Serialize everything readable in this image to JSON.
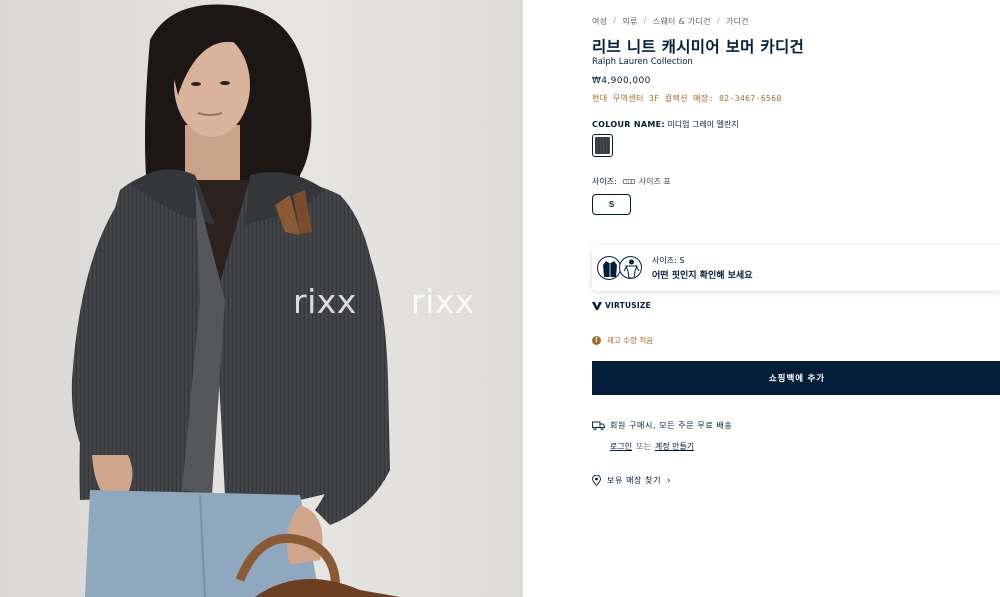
{
  "breadcrumb": [
    "여성",
    "의류",
    "스웨터 & 가디건",
    "가디건"
  ],
  "breadcrumb_separator": "/",
  "product": {
    "title": "리브 니트 캐시미어 보머 카디건",
    "brand": "Ralph Lauren Collection",
    "price": "₩4,900,000",
    "store_note": "현대 무역센터 3F 컬렉션 매장: 02-3467-6560"
  },
  "colour": {
    "label": "COLOUR NAME:",
    "value": "미디엄 그레이 멜란지",
    "swatch_color": "#3d3e41"
  },
  "size": {
    "label": "사이즈:",
    "chart_link": "사이즈 표",
    "selected": "S"
  },
  "virtusize": {
    "size_text": "사이즈: S",
    "message": "어떤 핏인지 확인해 보세요",
    "brand": "VIRTUSIZE"
  },
  "stock": {
    "text": "재고 수량 적음"
  },
  "add_to_bag": "쇼핑백에 추가",
  "shipping": {
    "text": "회원 구매시, 모든 주문 무료 배송"
  },
  "account": {
    "login": "로그인",
    "or": "또는",
    "create": "계정 만들기"
  },
  "store_finder": "보유 매장 찾기",
  "watermarks": [
    "rixx",
    "rixx"
  ],
  "colors": {
    "navy": "#041e3a",
    "accent": "#a66a2c",
    "white": "#ffffff"
  }
}
